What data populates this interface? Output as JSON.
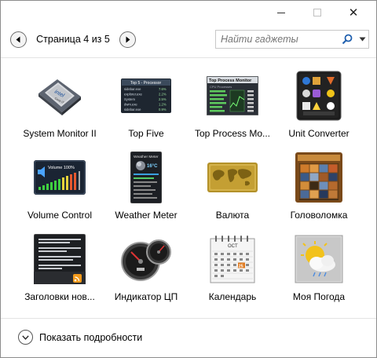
{
  "window": {
    "controls": {
      "minimize": "minimize",
      "maximize": "maximize",
      "close": "✕"
    }
  },
  "pager": {
    "label": "Страница 4 из 5"
  },
  "search": {
    "placeholder": "Найти гаджеты"
  },
  "gadgets": [
    {
      "name": "System Monitor II",
      "icon": "cpu-chip-icon"
    },
    {
      "name": "Top Five",
      "icon": "top-five-icon"
    },
    {
      "name": "Top Process Mo...",
      "icon": "top-process-monitor-icon"
    },
    {
      "name": "Unit Converter",
      "icon": "unit-converter-icon"
    },
    {
      "name": "Volume Control",
      "icon": "volume-control-icon"
    },
    {
      "name": "Weather Meter",
      "icon": "weather-meter-icon"
    },
    {
      "name": "Валюта",
      "icon": "currency-map-icon"
    },
    {
      "name": "Головоломка",
      "icon": "puzzle-icon"
    },
    {
      "name": "Заголовки нов...",
      "icon": "news-headlines-icon"
    },
    {
      "name": "Индикатор ЦП",
      "icon": "cpu-gauge-icon"
    },
    {
      "name": "Календарь",
      "icon": "calendar-icon"
    },
    {
      "name": "Моя Погода",
      "icon": "my-weather-icon"
    }
  ],
  "thumb_text": {
    "top_five_title": "Top 5 - Processor",
    "top_five_rows": [
      {
        "name": "sidebar.exe",
        "value": "7.6%"
      },
      {
        "name": "explorer.exe",
        "value": "2.2%"
      },
      {
        "name": "System",
        "value": "2.5%"
      },
      {
        "name": "dwm.exe",
        "value": "1.2%"
      },
      {
        "name": "sidebar.exe",
        "value": "0.9%"
      }
    ],
    "top_process_title": "Top Process Monitor",
    "top_process_header": "CPU Processes",
    "weather_meter_title": "Weather Meter",
    "weather_meter_temp": "16°C",
    "volume_label": "Volume 100%",
    "calendar_month": "OCT",
    "calendar_day": "25"
  },
  "details": {
    "label": "Показать подробности"
  },
  "colors": {
    "border": "#8c8c8c",
    "separator": "#e3e3e3",
    "placeholder": "#7a7a7a"
  }
}
